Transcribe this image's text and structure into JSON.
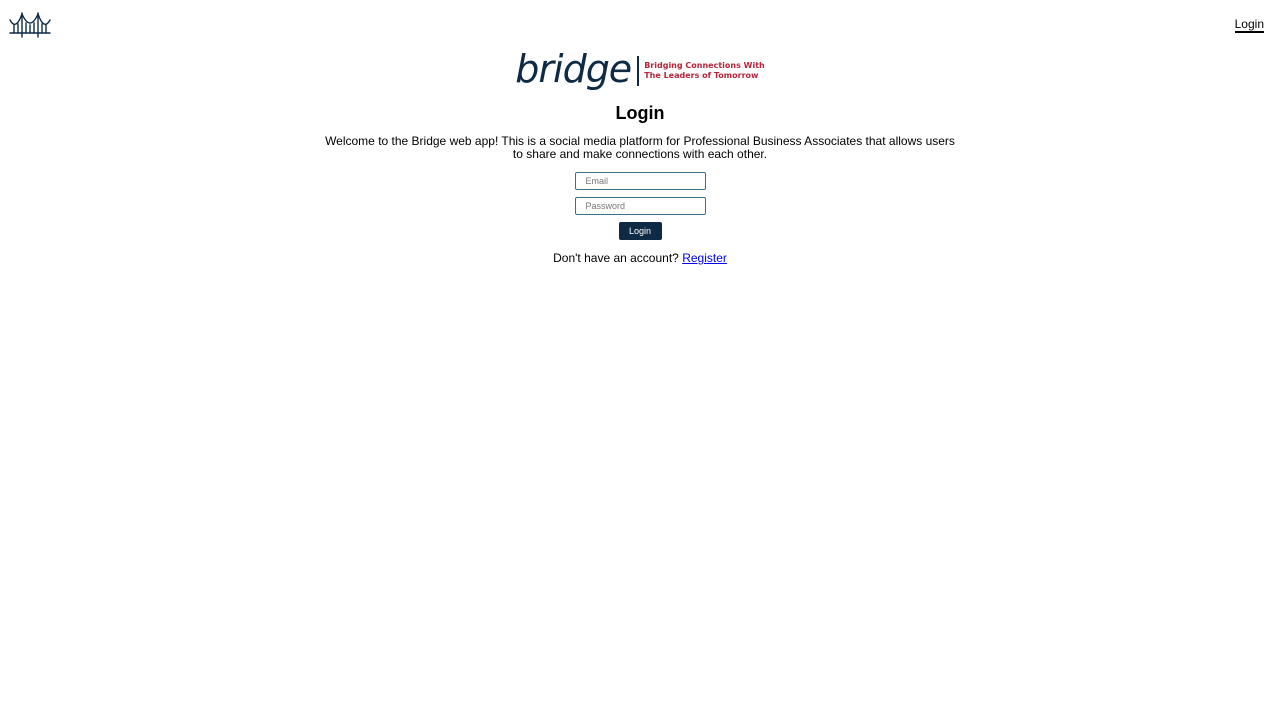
{
  "nav": {
    "login_label": "Login"
  },
  "logo": {
    "wordmark": "bridge",
    "tagline_line1": "Bridging Connections With",
    "tagline_line2": "The Leaders of Tomorrow"
  },
  "page": {
    "title": "Login",
    "welcome": "Welcome to the Bridge web app! This is a social media platform for Professional Business Associates that allows users to share and make connections with each other."
  },
  "form": {
    "email_placeholder": "Email",
    "email_value": "",
    "password_placeholder": "Password",
    "password_value": "",
    "submit_label": "Login"
  },
  "register": {
    "prompt": "Don't have an account?",
    "link_label": "Register"
  },
  "icons": {
    "nav_icon": "bridge-icon"
  },
  "colors": {
    "brand_navy": "#0f2a44",
    "brand_red": "#b8253a",
    "field_border": "#3b6f8a",
    "link_blue": "#0000ee"
  }
}
